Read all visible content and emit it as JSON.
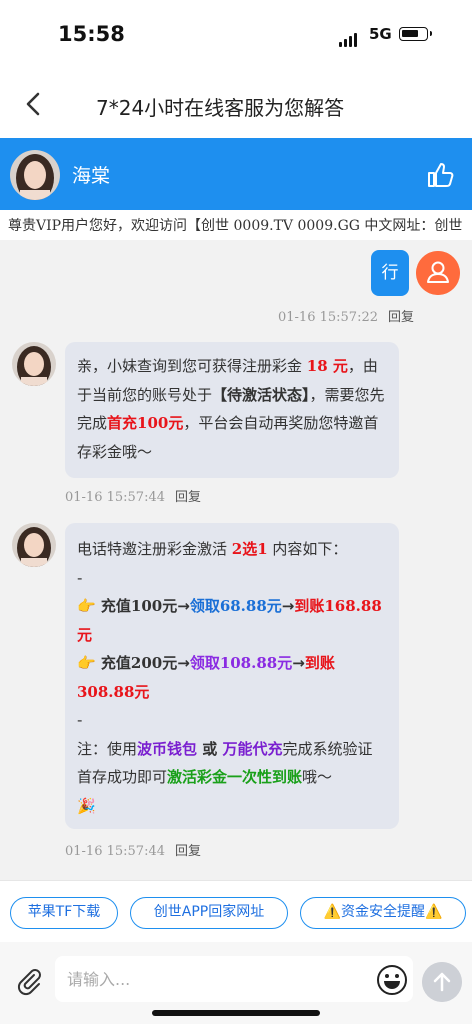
{
  "status_bar": {
    "time": "15:58",
    "network": "5G"
  },
  "nav": {
    "title": "7*24小时在线客服为您解答"
  },
  "agent": {
    "name": "海棠"
  },
  "marquee": {
    "text": "尊贵VIP用户您好，欢迎访问【创世 0009.TV 0009.GG 中文网址：创世"
  },
  "messages": {
    "user_msg": {
      "text": "行",
      "time": "01-16 15:57:22",
      "reply": "回复"
    },
    "msg1": {
      "parts": [
        "亲，小妹查询到您可获得注册彩金 ",
        "18 元",
        "，由于当前您的账号处于",
        "【待激活状态】",
        "，需要您先完成",
        "首充",
        "100元",
        "，平台会自动再奖励您特邀首存彩金哦～"
      ],
      "time": "01-16 15:57:44",
      "reply": "回复"
    },
    "msg2": {
      "intro": [
        "电话特邀注册彩金激活 ",
        "2选1",
        " 内容如下："
      ],
      "dash": "-",
      "option1": [
        "👉",
        " 充值",
        "100元",
        "→",
        "领取68.88元",
        "→",
        "到账168.88元"
      ],
      "option2": [
        "👉",
        " 充值",
        "200元",
        "→",
        "领取108.88元",
        "→",
        "到账308.88元"
      ],
      "note": [
        "注：使用",
        "波币钱包",
        " 或 ",
        "万能代充",
        "完成系统验证首存成功即可",
        "激活彩金一次性到账",
        "哦～"
      ],
      "party": "🎉",
      "time": "01-16 15:57:44",
      "reply": "回复"
    }
  },
  "quick_buttons": [
    "苹果TF下载",
    "创世APP回家网址",
    "⚠️资金安全提醒⚠️"
  ],
  "composer": {
    "placeholder": "请输入..."
  },
  "icons": [
    "back-icon",
    "thumb-up-icon",
    "paperclip-icon",
    "smile-icon",
    "send-icon",
    "user-icon"
  ],
  "colors": {
    "accent": "#1e8fef",
    "user_avatar": "#ff6b3d",
    "red": "#e8141a",
    "green": "#1aa01a",
    "purple": "#8a2be2"
  }
}
